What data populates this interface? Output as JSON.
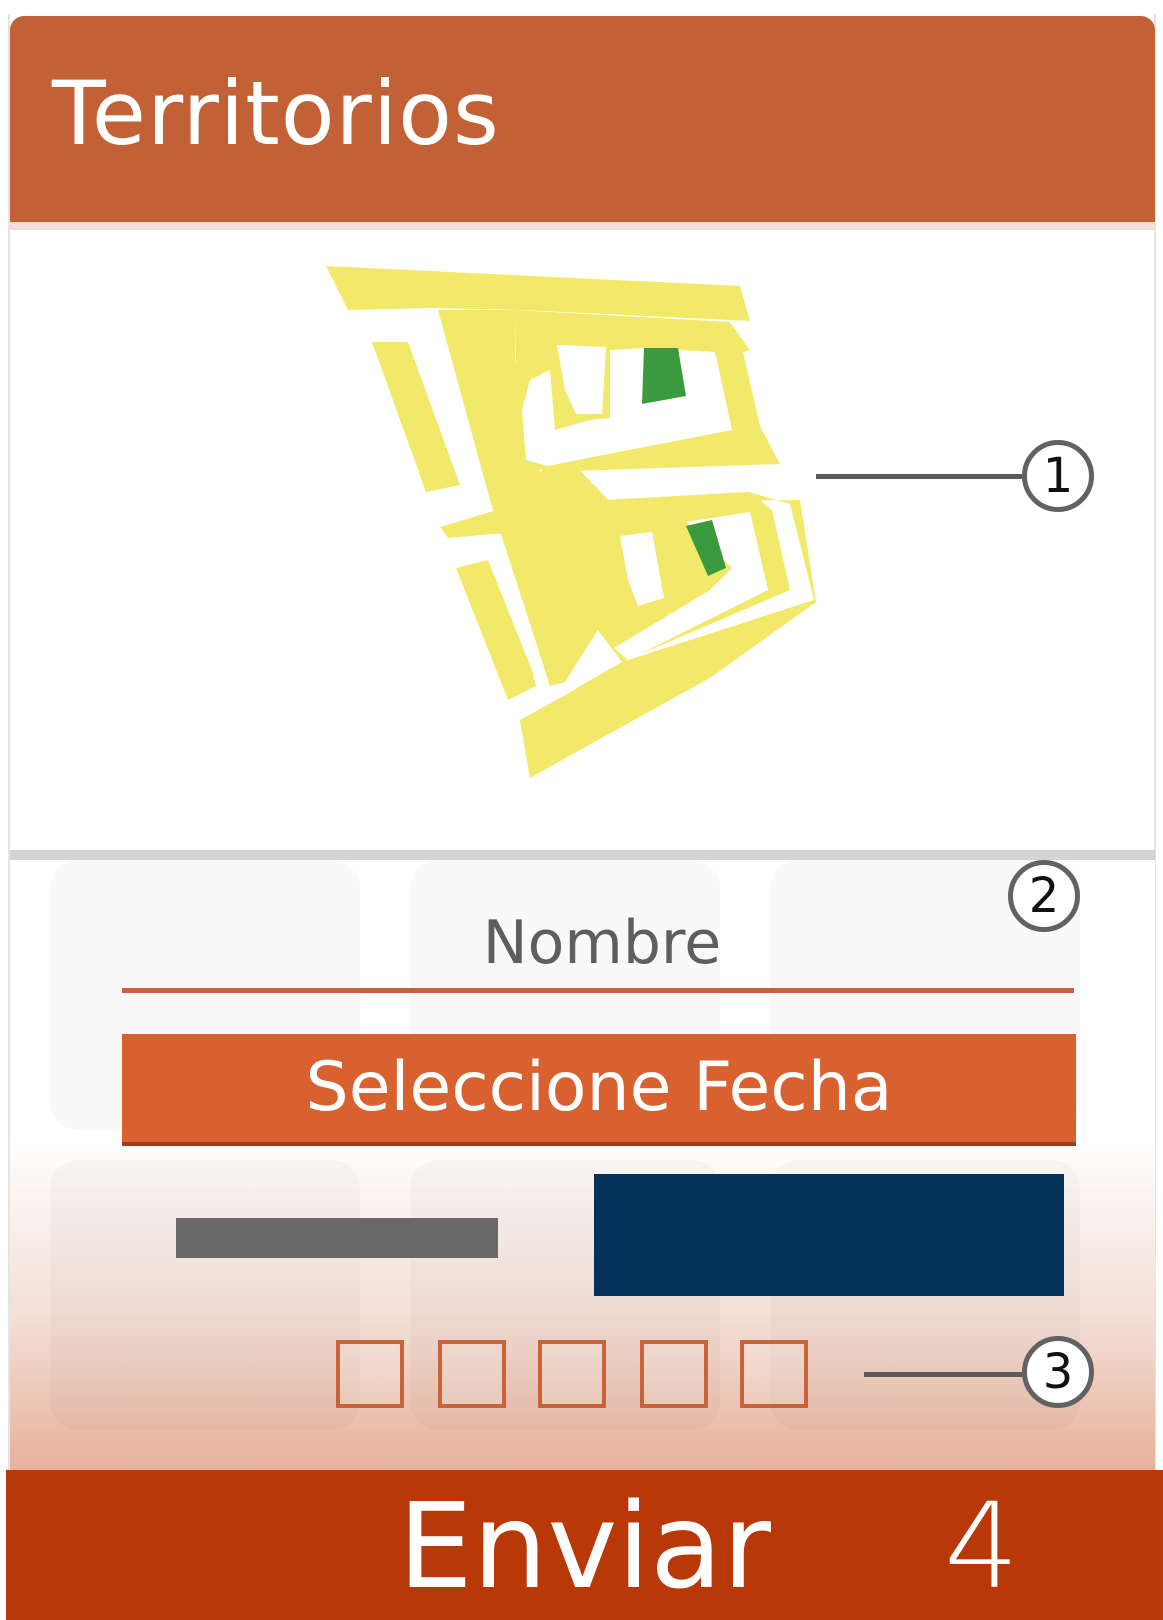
{
  "header": {
    "title": "Territorios"
  },
  "map": {
    "label": "territory-map",
    "colors": {
      "block": "#f2e96a",
      "highlight": "#3c9a3e"
    }
  },
  "form": {
    "name_label": "Nombre",
    "date_button_label": "Seleccione Fecha",
    "pin_count": 5
  },
  "footer": {
    "send_label": "Enviar",
    "send_count": "4"
  },
  "callouts": [
    "1",
    "2",
    "3"
  ],
  "colors": {
    "header": "#c26036",
    "accent": "#d9612f",
    "footer": "#b93808",
    "navy": "#033159",
    "gray": "#686868"
  }
}
